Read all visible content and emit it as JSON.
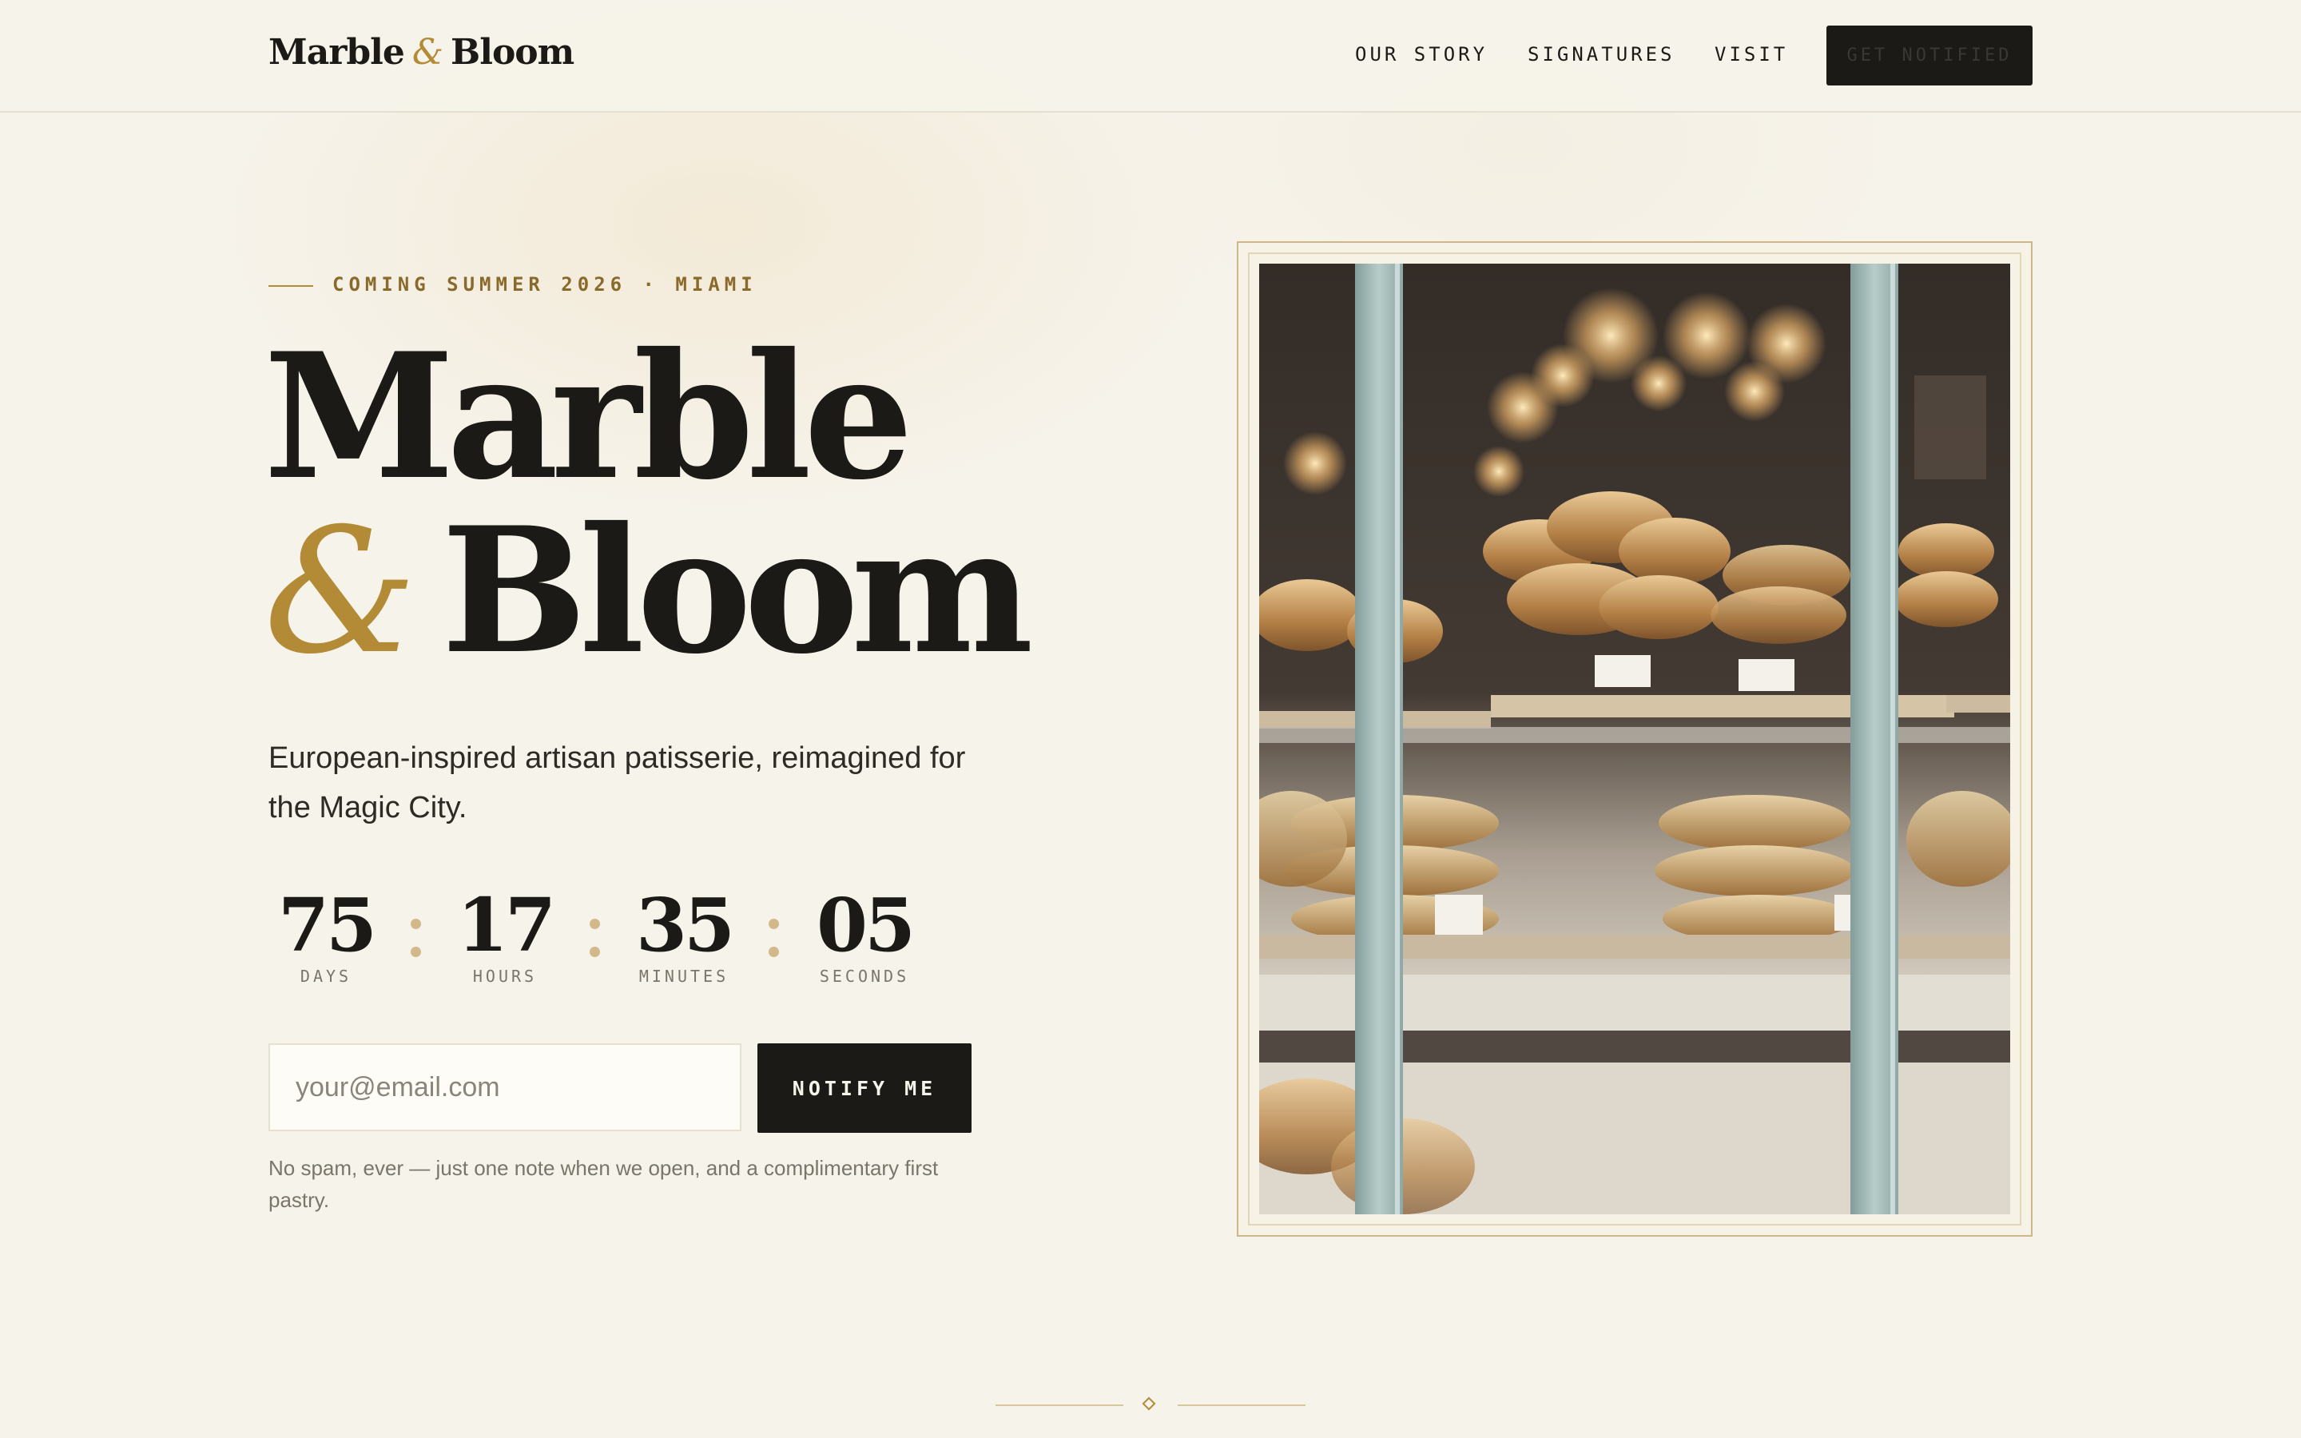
{
  "brand": {
    "name_part1": "Marble",
    "ampersand": "&",
    "name_part2": "Bloom"
  },
  "nav": {
    "links": [
      "OUR STORY",
      "SIGNATURES",
      "VISIT"
    ],
    "cta_label": "GET NOTIFIED"
  },
  "hero": {
    "eyebrow": "COMING SUMMER 2026 · MIAMI",
    "title_line1": "Marble",
    "title_amp": "&",
    "title_line2": "Bloom",
    "tagline_line1": "European-inspired artisan patisserie, reimagined for",
    "tagline_line2": "the Magic City."
  },
  "countdown": [
    {
      "value": "75",
      "label": "DAYS"
    },
    {
      "value": "17",
      "label": "HOURS"
    },
    {
      "value": "35",
      "label": "MINUTES"
    },
    {
      "value": "05",
      "label": "SECONDS"
    }
  ],
  "signup": {
    "email_placeholder": "your@email.com",
    "email_value": "",
    "button_label": "NOTIFY ME",
    "fine_print_line1": "No spam, ever — just one note when we open, and a complimentary first",
    "fine_print_line2": "pastry."
  },
  "colors": {
    "background": "#f6f3ea",
    "ink": "#1c1a17",
    "gold_accent": "#b38a35",
    "muted_text": "#7a756a"
  },
  "icons": {
    "divider": "diamond-divider-icon"
  }
}
